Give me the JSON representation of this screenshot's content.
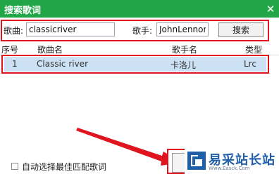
{
  "window": {
    "title": "搜索歌词",
    "close_glyph": "✕"
  },
  "search": {
    "song_label": "歌曲:",
    "song_value": "classicriver",
    "artist_label": "歌手:",
    "artist_value": "JohnLennon",
    "search_button": "搜索"
  },
  "table": {
    "headers": [
      "序号",
      "歌曲名",
      "歌手名",
      "类型"
    ],
    "rows": [
      [
        "1",
        "Classic river",
        "卡洛儿",
        "Lrc"
      ]
    ]
  },
  "options": {
    "auto_select_label": "自动选择最佳匹配歌词",
    "auto_select_checked": false
  },
  "watermark": {
    "name": "易采站长站",
    "sub": "Www.Easck.Com"
  },
  "colors": {
    "titlebar": "#20a646",
    "highlight": "#e0141e",
    "selected_row": "#cce1f4",
    "watermark": "#1f5fa9"
  }
}
